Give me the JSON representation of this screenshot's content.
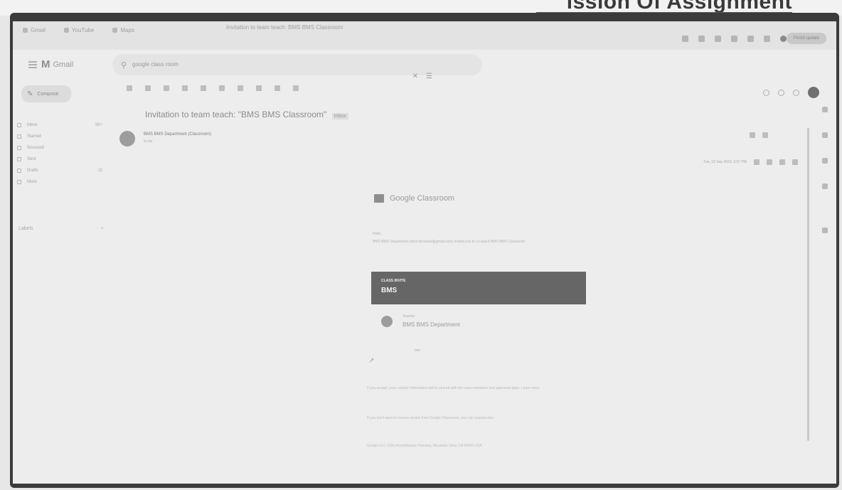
{
  "page_heading": "ission Of Assignment",
  "browser": {
    "bookmarks": [
      "Gmail",
      "YouTube",
      "Maps"
    ],
    "tab_title": "Invitation to team teach: BMS BMS Classroom",
    "update_button": "Finish update"
  },
  "gmail": {
    "logo_text": "Gmail",
    "search_value": "google class room",
    "compose_label": "Compose",
    "nav_items": [
      {
        "label": "Inbox",
        "count": "99+"
      },
      {
        "label": "Starred",
        "count": ""
      },
      {
        "label": "Snoozed",
        "count": ""
      },
      {
        "label": "Sent",
        "count": ""
      },
      {
        "label": "Drafts",
        "count": "15"
      },
      {
        "label": "More",
        "count": ""
      }
    ],
    "labels_header": "Labels",
    "labels_add": "+"
  },
  "email": {
    "subject": "Invitation to team teach: \"BMS BMS Classroom\"",
    "folder_badge": "Inbox",
    "sender": "BMS BMS Department (Classroom)",
    "recipient_line": "to me",
    "time": "Tue, 19 Sep 2023, 3:07 PM"
  },
  "classroom": {
    "brand": "Google Classroom",
    "greeting": "Hello,",
    "invite_text": "BMS BMS Department (bms.bmsdept@gmail.com) invited you to co-teach BMS BMS Classroom",
    "banner_label": "CLASS INVITE",
    "class_name": "BMS",
    "teacher_role": "Teacher",
    "teacher_name": "BMS BMS Department",
    "join_label": "Join",
    "notice_1": "If you accept, your contact information will be shared with the class members and approved apps. Learn more",
    "notice_2": "If you don't want to receive emails from Google Classroom, you can unsubscribe.",
    "footer": "Google LLC 1600 Amphitheatre Parkway, Mountain View, CA 94043 USA"
  }
}
